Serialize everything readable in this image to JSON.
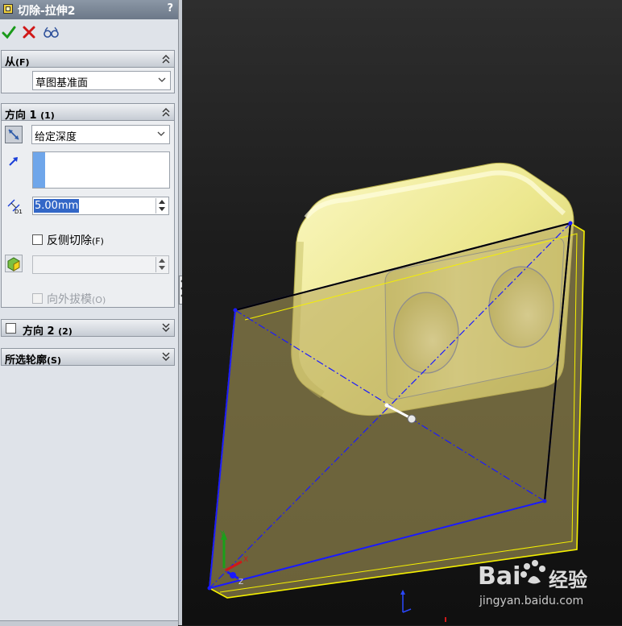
{
  "property_manager": {
    "title": "切除-拉伸2",
    "help": "?",
    "actions": {
      "ok_icon": "checkmark-icon",
      "cancel_icon": "x-icon",
      "preview_icon": "glasses-icon"
    },
    "from": {
      "header": "从",
      "header_key": "(F)",
      "start_condition": "草图基准面"
    },
    "direction1": {
      "header": "方向 1",
      "header_key": "(1)",
      "end_condition": "给定深度",
      "depth": "5.00mm",
      "flip_side_label": "反侧切除",
      "flip_side_key": "(F)",
      "flip_side_checked": false,
      "draft_outward_label": "向外拔模",
      "draft_outward_key": "(O)",
      "draft_outward_enabled": false
    },
    "direction2": {
      "header": "方向 2",
      "header_key": "(2)",
      "checked": false
    },
    "selected_contours": {
      "header": "所选轮廓",
      "header_key": "(S)"
    }
  },
  "watermark": {
    "logo_left": "Bai",
    "logo_right": "经验",
    "url": "jingyan.baidu.com"
  },
  "triad": {
    "x": "X",
    "y": "Y",
    "z": "Z"
  },
  "colors": {
    "panel_bg": "#dfe3e9",
    "header_bar": "#7c8898",
    "part_yellow": "#f3ef9c",
    "sketch_blue": "#1a1aff",
    "preview_edge": "#f5f000"
  }
}
